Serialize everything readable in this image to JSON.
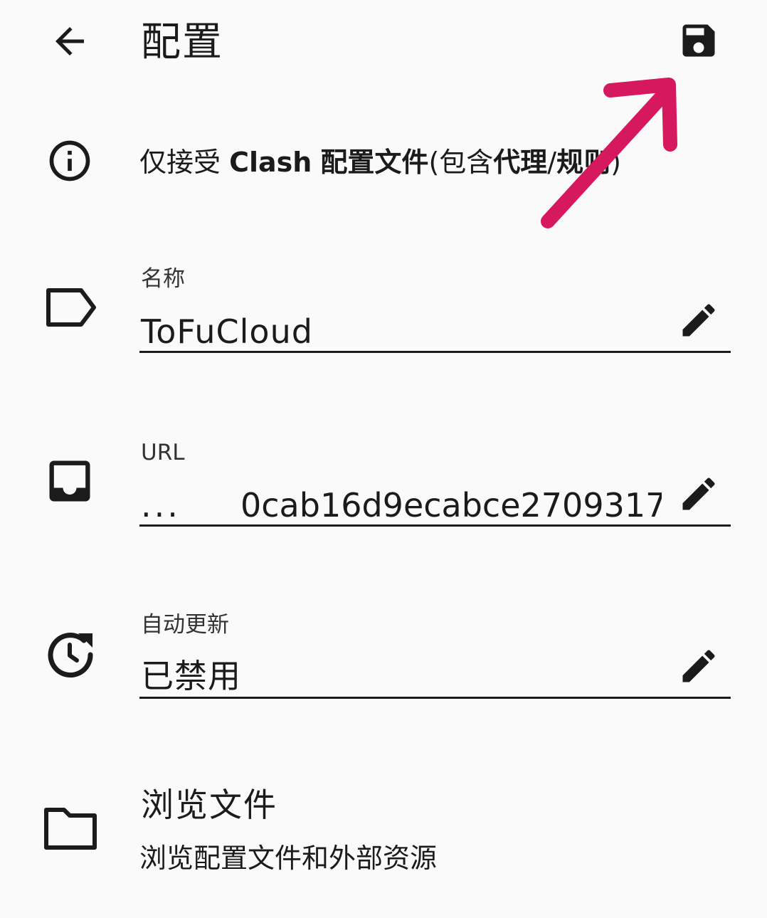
{
  "header": {
    "title": "配置",
    "back_icon": "arrow-left-icon",
    "save_icon": "floppy-disk-icon"
  },
  "notice": {
    "icon": "info-circle-icon",
    "prefix": "仅接受 ",
    "clash": "Clash",
    "sp": " ",
    "config_file": "配置文件",
    "paren_open": "(包含",
    "proxy": "代理",
    "slash": "/",
    "rules": "规则",
    "paren_close": ")"
  },
  "fields": {
    "name": {
      "label": "名称",
      "value": "ToFuCloud",
      "icon": "label-tag-icon"
    },
    "url": {
      "label": "URL",
      "prefix": "...",
      "value": "0cab16d9ecabce2709317",
      "icon": "inbox-icon"
    },
    "auto_update": {
      "label": "自动更新",
      "value": "已禁用",
      "icon": "update-clock-icon"
    }
  },
  "browse": {
    "title": "浏览文件",
    "subtitle": "浏览配置文件和外部资源",
    "icon": "folder-icon"
  },
  "colors": {
    "background": "#fafafa",
    "text": "#1b1b1b",
    "annotation_arrow": "#d6185e"
  }
}
